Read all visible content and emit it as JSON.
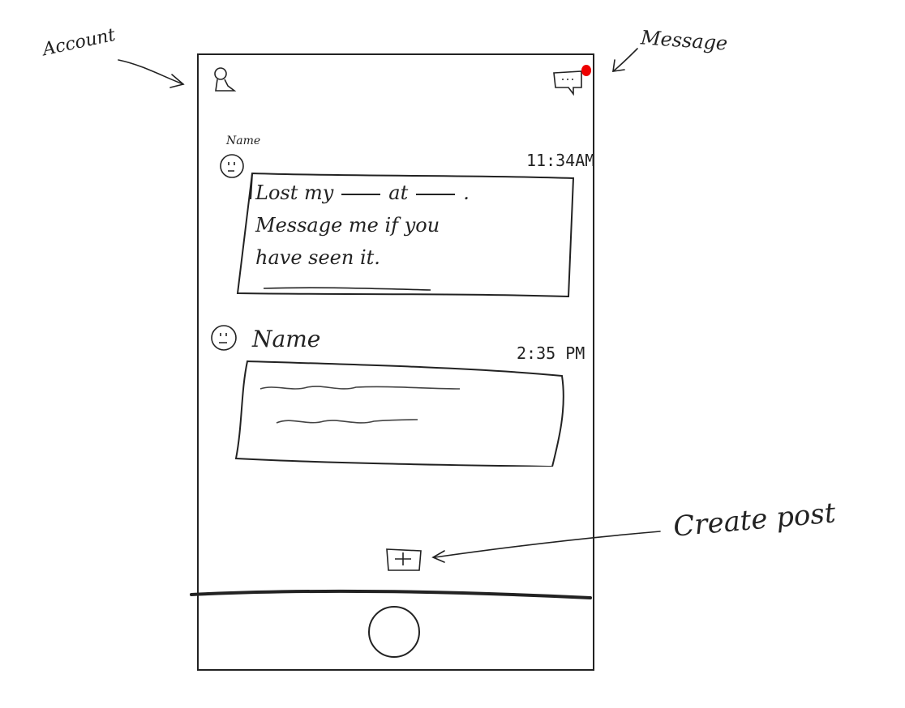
{
  "annotations": {
    "account": "Account",
    "message": "Message",
    "create_post": "Create post"
  },
  "icons": {
    "account": "account-icon",
    "message": "message-icon",
    "create_post": "plus-square-icon",
    "avatar": "smiley-face-icon",
    "home": "home-button-circle"
  },
  "colors": {
    "notification_dot": "#e00000",
    "ink": "#222222"
  },
  "feed": {
    "posts": [
      {
        "name": "Name",
        "time": "11:34AM",
        "body_line1_a": "Lost my",
        "body_line1_b": "at",
        "body_line2": "Message me if you",
        "body_line3": "have seen it."
      },
      {
        "name": "Name",
        "time": "2:35 PM"
      }
    ]
  }
}
